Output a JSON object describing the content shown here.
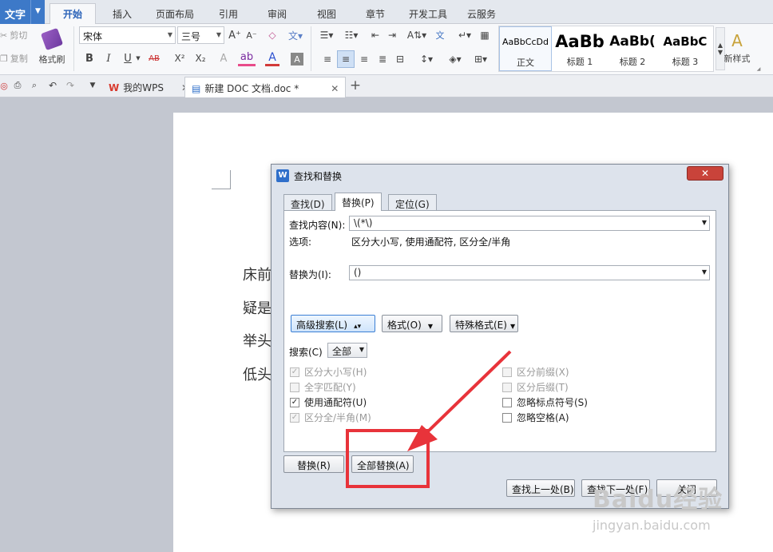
{
  "app": {
    "menu_label": "文字"
  },
  "ribbon_tabs": [
    "开始",
    "插入",
    "页面布局",
    "引用",
    "审阅",
    "视图",
    "章节",
    "开发工具",
    "云服务"
  ],
  "ribbon": {
    "cut": "剪切",
    "copy": "复制",
    "format_painter": "格式刷",
    "font_name": "宋体",
    "font_size": "三号",
    "bold": "B",
    "italic": "I",
    "underline": "U",
    "strike": "AB",
    "superscript": "X²",
    "subscript": "X₂",
    "styles": [
      {
        "preview": "AaBbCcDd",
        "name": "正文"
      },
      {
        "preview": "AaBb",
        "name": "标题 1"
      },
      {
        "preview": "AaBb(",
        "name": "标题 2"
      },
      {
        "preview": "AaBbC",
        "name": "标题 3"
      }
    ],
    "new_style": "新样式"
  },
  "doc_tabs": [
    {
      "label": "我的WPS"
    },
    {
      "label": "新建 DOC 文档.doc *"
    }
  ],
  "document": {
    "lines": [
      "床前",
      "疑是",
      "举头",
      "低头"
    ]
  },
  "dialog": {
    "title": "查找和替换",
    "tabs": [
      "查找(D)",
      "替换(P)",
      "定位(G)"
    ],
    "find_label": "查找内容(N):",
    "find_value": "\\(*\\)",
    "options_label": "选项:",
    "options_value": "区分大小写, 使用通配符, 区分全/半角",
    "replace_label": "替换为(I):",
    "replace_value": "()",
    "advanced_button": "高级搜索(L)",
    "format_button": "格式(O)",
    "special_button": "特殊格式(E)",
    "search_label": "搜索(C)",
    "search_value": "全部",
    "left_checks": [
      {
        "label": "区分大小写(H)",
        "checked": true,
        "disabled": true
      },
      {
        "label": "全字匹配(Y)",
        "checked": false,
        "disabled": true
      },
      {
        "label": "使用通配符(U)",
        "checked": true,
        "disabled": false
      },
      {
        "label": "区分全/半角(M)",
        "checked": true,
        "disabled": true
      }
    ],
    "right_checks": [
      {
        "label": "区分前缀(X)",
        "checked": false,
        "disabled": true
      },
      {
        "label": "区分后缀(T)",
        "checked": false,
        "disabled": true
      },
      {
        "label": "忽略标点符号(S)",
        "checked": false,
        "disabled": false
      },
      {
        "label": "忽略空格(A)",
        "checked": false,
        "disabled": false
      }
    ],
    "replace_button": "替换(R)",
    "replace_all_button": "全部替换(A)",
    "find_prev_button": "查找上一处(B)",
    "find_next_button": "查找下一处(F)",
    "close_button": "关闭"
  },
  "watermark": {
    "brand": "Baidu经验",
    "url": "jingyan.baidu.com"
  },
  "colors": {
    "accent": "#3d79c8",
    "highlight": "#e8333a",
    "font_color": "#d23a3a",
    "text_color": "#2a4fd0"
  }
}
